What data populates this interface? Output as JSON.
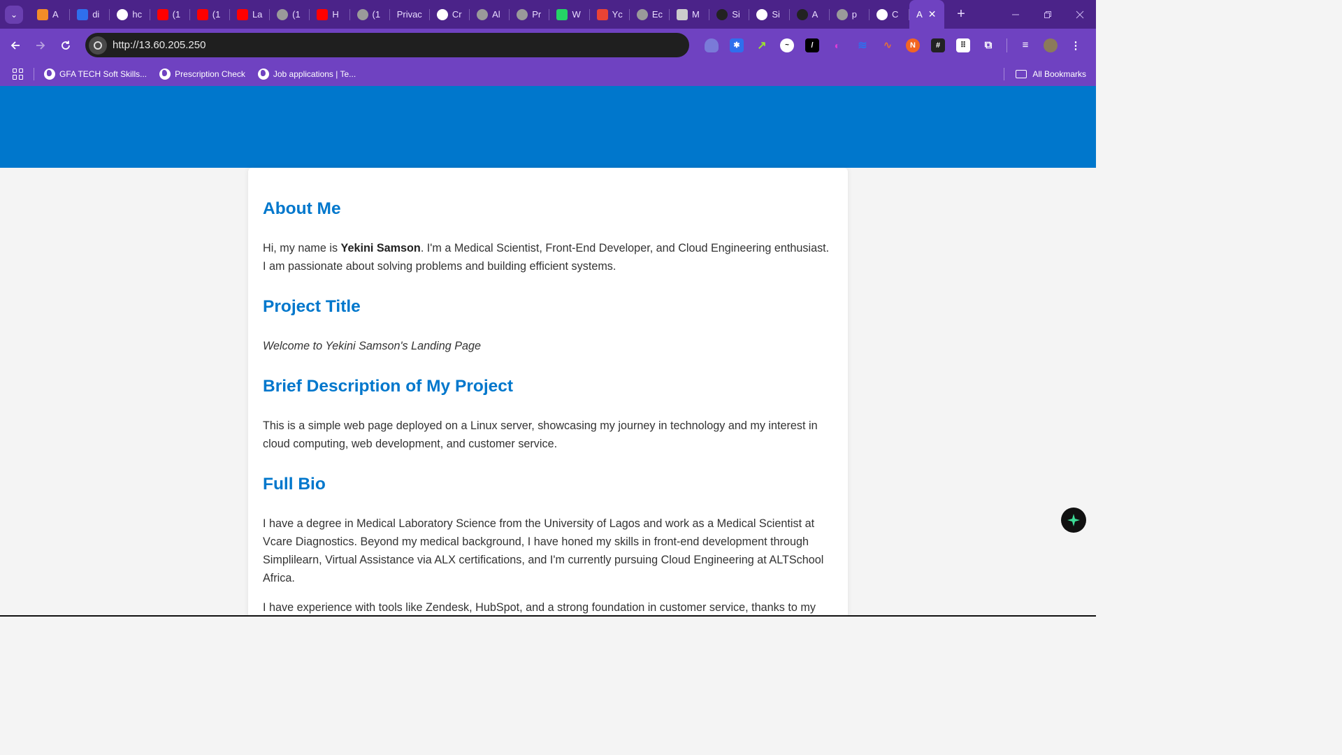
{
  "browser": {
    "tabs": [
      {
        "label": "A",
        "icon": "box-icon",
        "color": "#f28c28"
      },
      {
        "label": "di",
        "icon": "star-icon",
        "color": "#2f6fed"
      },
      {
        "label": "hc",
        "icon": "google-icon",
        "color": "#ffffff"
      },
      {
        "label": "(1",
        "icon": "youtube-icon",
        "color": "#ff0000"
      },
      {
        "label": "(1",
        "icon": "youtube-icon",
        "color": "#ff0000"
      },
      {
        "label": "La",
        "icon": "youtube-icon",
        "color": "#ff0000"
      },
      {
        "label": "(1",
        "icon": "globe-icon",
        "color": "#9a9a9a"
      },
      {
        "label": "H",
        "icon": "youtube-icon",
        "color": "#ff0000"
      },
      {
        "label": "(1",
        "icon": "globe-icon",
        "color": "#9a9a9a"
      },
      {
        "label": "Privac",
        "icon": "",
        "color": ""
      },
      {
        "label": "Cr",
        "icon": "ghost-icon",
        "color": "#ffffff"
      },
      {
        "label": "Al",
        "icon": "globe-icon",
        "color": "#9a9a9a"
      },
      {
        "label": "Pr",
        "icon": "globe-icon",
        "color": "#9a9a9a"
      },
      {
        "label": "W",
        "icon": "whatsapp-icon",
        "color": "#25d366"
      },
      {
        "label": "Yc",
        "icon": "gmail-icon",
        "color": "#ea4335"
      },
      {
        "label": "Ec",
        "icon": "globe-icon",
        "color": "#9a9a9a"
      },
      {
        "label": "M",
        "icon": "mail-icon",
        "color": "#cccccc"
      },
      {
        "label": "Si",
        "icon": "github-icon",
        "color": "#222222"
      },
      {
        "label": "Si",
        "icon": "google-icon",
        "color": "#ffffff"
      },
      {
        "label": "A",
        "icon": "github-icon",
        "color": "#222222"
      },
      {
        "label": "p",
        "icon": "globe-icon",
        "color": "#9a9a9a"
      },
      {
        "label": "C",
        "icon": "openai-icon",
        "color": "#ffffff"
      }
    ],
    "active_tab": {
      "label": "A",
      "close": "✕"
    },
    "new_tab": "+",
    "url": "http://13.60.205.250",
    "bookmarks": [
      {
        "label": "GFA TECH Soft Skills..."
      },
      {
        "label": "Prescription Check"
      },
      {
        "label": "Job applications | Te..."
      }
    ],
    "all_bookmarks": "All Bookmarks"
  },
  "page": {
    "colors": {
      "hero": "#0077cc",
      "heading": "#0077cc",
      "text": "#333333"
    },
    "about": {
      "title": "About Me",
      "intro_before": "Hi, my name is ",
      "name": "Yekini Samson",
      "intro_after": ". I'm a Medical Scientist, Front-End Developer, and Cloud Engineering enthusiast. I am passionate about solving problems and building efficient systems."
    },
    "project": {
      "title": "Project Title",
      "text": "Welcome to Yekini Samson's Landing Page"
    },
    "description": {
      "title": "Brief Description of My Project",
      "text": "This is a simple web page deployed on a Linux server, showcasing my journey in technology and my interest in cloud computing, web development, and customer service."
    },
    "bio": {
      "title": "Full Bio",
      "p1": "I have a degree in Medical Laboratory Science from the University of Lagos and work as a Medical Scientist at Vcare Diagnostics. Beyond my medical background, I have honed my skills in front-end development through Simplilearn, Virtual Assistance via ALX certifications, and I'm currently pursuing Cloud Engineering at ALTSchool Africa.",
      "p2": "I have experience with tools like Zendesk, HubSpot, and a strong foundation in customer service, thanks to my time as a Customer Care Representative at Jumia Nigeria. My hobbies include learning new technologies,"
    }
  }
}
